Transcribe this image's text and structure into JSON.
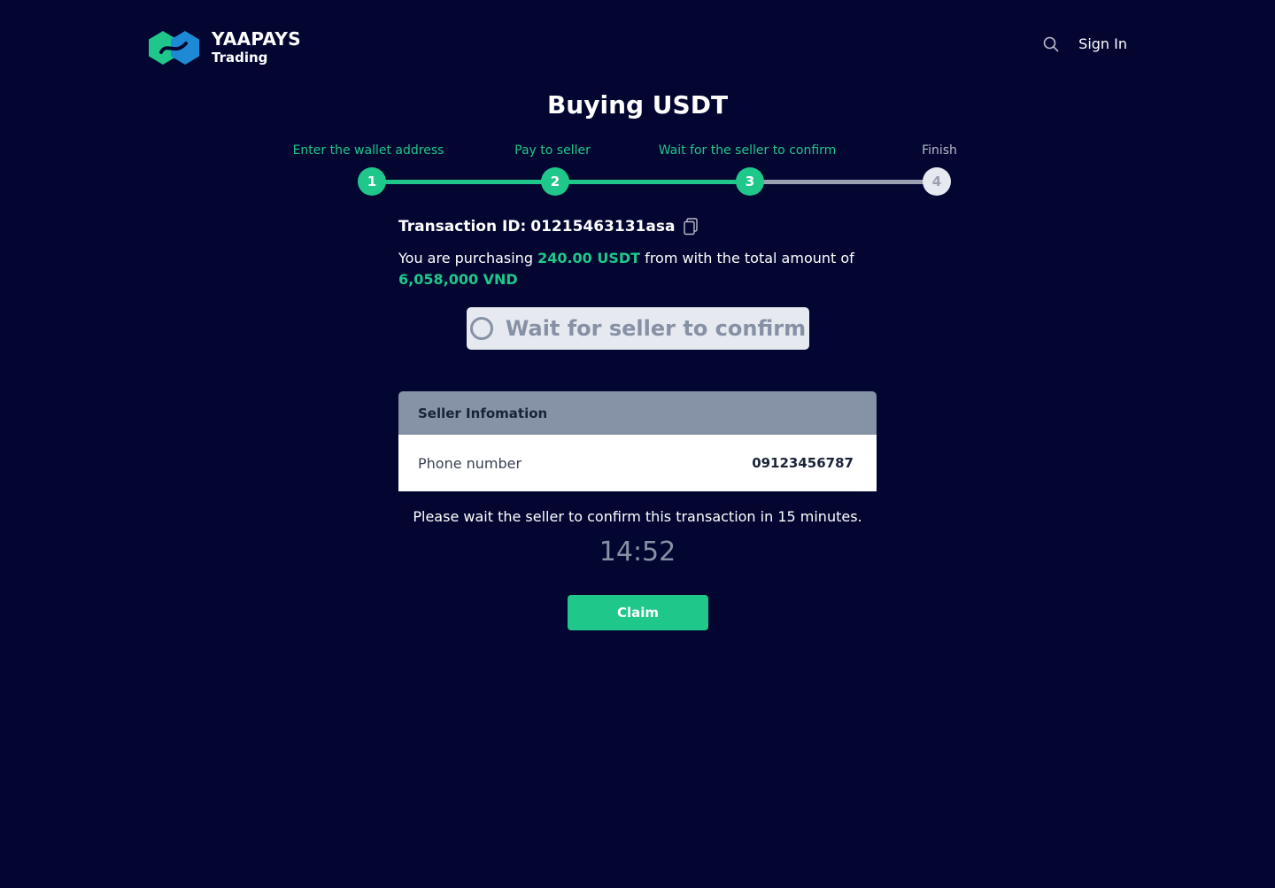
{
  "brand": {
    "name": "YAAPAYS",
    "subtitle": "Trading"
  },
  "header": {
    "search_icon": "search-icon",
    "signin_label": "Sign In"
  },
  "page_title": "Buying USDT",
  "stepper": {
    "steps": [
      {
        "number": "1",
        "label": "Enter the wallet address",
        "status": "done"
      },
      {
        "number": "2",
        "label": "Pay to seller",
        "status": "done"
      },
      {
        "number": "3",
        "label": "Wait for the seller to confirm",
        "status": "current"
      },
      {
        "number": "4",
        "label": "Finish",
        "status": "pending"
      }
    ]
  },
  "transaction": {
    "label": "Transaction ID:",
    "id": "01215463131asa"
  },
  "summary": {
    "prefix": "You are purchasing ",
    "amount": "240.00 USDT",
    "middle": " from with the total amount of ",
    "total": "6,058,000 VND"
  },
  "status_button": {
    "label": "Wait for seller to confirm"
  },
  "seller_info": {
    "title": "Seller Infomation",
    "rows": [
      {
        "label": "Phone number",
        "value": "09123456787"
      }
    ]
  },
  "notice": "Please wait the seller to confirm this transaction in 15 minutes.",
  "timer": "14:52",
  "claim_label": "Claim",
  "colors": {
    "background": "#020631",
    "accent": "#1fc78a",
    "pending": "#9aa0b2"
  }
}
